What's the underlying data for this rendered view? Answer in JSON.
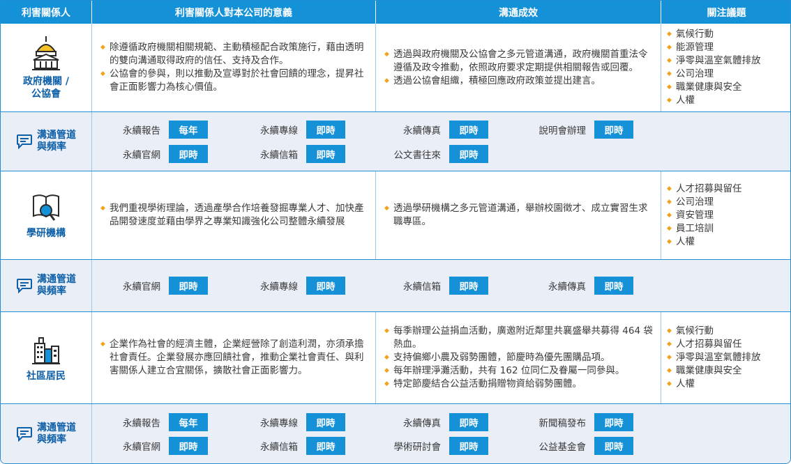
{
  "header": {
    "col1": "利害關係人",
    "col2": "利害關係人對本公司的意義",
    "col3": "溝通成效",
    "col4": "關注議題"
  },
  "channel_label": "溝通管道\n與頻率",
  "sections": [
    {
      "name": "政府機關 /\n公協會",
      "icon": "government-building-icon",
      "meaning": [
        "除遵循政府機關相關規範、主動積極配合政策施行，藉由透明的雙向溝通取得政府的信任、支持及合作。",
        "公協會的參與，則以推動及宣導對於社會回饋的理念，提昇社會正面影響力為核心價值。"
      ],
      "effects": [
        "透過與政府機關及公協會之多元管道溝通，政府機關首重法令遵循及政令推動，依照政府要求定期提供相關報告或回覆。",
        "透過公協會組織，積極回應政府政策並提出建言。"
      ],
      "issues": [
        "氣候行動",
        "能源管理",
        "淨零與溫室氣體排放",
        "公司治理",
        "職業健康與安全",
        "人權"
      ],
      "channels": [
        {
          "name": "永續報告",
          "freq": "每年"
        },
        {
          "name": "永續專線",
          "freq": "即時"
        },
        {
          "name": "永續傳真",
          "freq": "即時"
        },
        {
          "name": "說明會辦理",
          "freq": "即時"
        },
        {
          "name": "永續官網",
          "freq": "即時"
        },
        {
          "name": "永續信箱",
          "freq": "即時"
        },
        {
          "name": "公文書往來",
          "freq": "即時"
        }
      ]
    },
    {
      "name": "學研機構",
      "icon": "research-book-icon",
      "meaning": [
        "我們重視學術理論，透過產學合作培養發掘專業人才、加快產品開發速度並藉由學界之專業知識強化公司整體永續發展"
      ],
      "effects": [
        "透過學研機構之多元管道溝通，舉辦校園徵才、成立實習生求職專區。"
      ],
      "issues": [
        "人才招募與留任",
        "公司治理",
        "資安管理",
        "員工培訓",
        "人權"
      ],
      "channels": [
        {
          "name": "永續官網",
          "freq": "即時"
        },
        {
          "name": "永續專線",
          "freq": "即時"
        },
        {
          "name": "永續信箱",
          "freq": "即時"
        },
        {
          "name": "永續傳真",
          "freq": "即時"
        }
      ]
    },
    {
      "name": "社區居民",
      "icon": "community-buildings-icon",
      "meaning": [
        "企業作為社會的經濟主體，企業經營除了創造利潤，亦須承擔社會責任。企業發展亦應回饋社會，推動企業社會責任、與利害關係人建立合宜關係，擴散社會正面影響力。"
      ],
      "effects": [
        "每季辦理公益捐血活動，廣邀附近鄰里共襄盛舉共募得 464 袋熱血。",
        "支持偏鄉小農及弱勢團體，節慶時為優先團購品項。",
        "每年辦理淨灘活動，共有 162 位同仁及眷屬一同參與。",
        "特定節慶結合公益活動捐贈物資給弱勢團體。"
      ],
      "issues": [
        "氣候行動",
        "人才招募與留任",
        "淨零與溫室氣體排放",
        "職業健康與安全",
        "人權"
      ],
      "channels": [
        {
          "name": "永續報告",
          "freq": "每年"
        },
        {
          "name": "永續專線",
          "freq": "即時"
        },
        {
          "name": "永續傳真",
          "freq": "即時"
        },
        {
          "name": "新聞稿發布",
          "freq": "即時"
        },
        {
          "name": "永續官網",
          "freq": "即時"
        },
        {
          "name": "永續信箱",
          "freq": "即時"
        },
        {
          "name": "學術研討會",
          "freq": "即時"
        },
        {
          "name": "公益基金會",
          "freq": "即時"
        }
      ]
    }
  ],
  "colors": {
    "primary": "#1591d8",
    "text_blue": "#0d5fa8",
    "bullet": "#f3a21b",
    "channel_bg": "#e9eef7"
  }
}
